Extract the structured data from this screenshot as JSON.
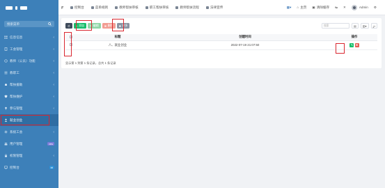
{
  "sidebar": {
    "search_placeholder": "搜索菜单",
    "items": [
      {
        "label": "信息信息",
        "icon": "grid-icon"
      },
      {
        "label": "工会管理",
        "icon": "doc-icon"
      },
      {
        "label": "教师（公员）功能",
        "icon": "circle-icon"
      },
      {
        "label": "教职工",
        "icon": "list-icon"
      },
      {
        "label": "帮扶援助",
        "icon": "hand-icon"
      },
      {
        "label": "帮扶维护",
        "icon": "shield-icon"
      },
      {
        "label": "参与管理",
        "icon": "pin-icon"
      },
      {
        "label": "就业创业",
        "icon": "user-icon",
        "active": true
      },
      {
        "label": "系统工会",
        "icon": "gear-icon"
      },
      {
        "label": "用户管理",
        "icon": "users-icon",
        "badge": "new"
      },
      {
        "label": "权限管理",
        "icon": "lock-icon"
      },
      {
        "label": "控制台",
        "icon": "monitor-icon",
        "badge": "bit"
      }
    ]
  },
  "topbar": {
    "tabs": [
      {
        "label": "控制台"
      },
      {
        "label": "菜单规则"
      },
      {
        "label": "教师帮扶审核"
      },
      {
        "label": "职工帮扶审核"
      },
      {
        "label": "教师帮扶流程"
      },
      {
        "label": "法律宣传"
      }
    ],
    "home_label": "主页",
    "clear_cache_label": "清除缓存",
    "username": "Admin"
  },
  "toolbar": {
    "refresh_icon": "refresh-icon",
    "add_label": "添加",
    "edit_label": "编辑",
    "delete_label": "删除",
    "more_label": "更多",
    "search_placeholder": "搜索"
  },
  "table": {
    "headers": [
      "",
      "标题",
      "创建时间",
      "操作"
    ],
    "rows": [
      {
        "title": "八、就业创业",
        "created": "2022-07-19 21:07:50"
      }
    ]
  },
  "pagination": {
    "summary": "显示第 1 到第 1 条记录，总共 1 条记录"
  },
  "colors": {
    "sidebar_bg": "#3d80b9",
    "add": "#19be6b",
    "delete": "#f29d93",
    "highlight": "#d9262f"
  }
}
